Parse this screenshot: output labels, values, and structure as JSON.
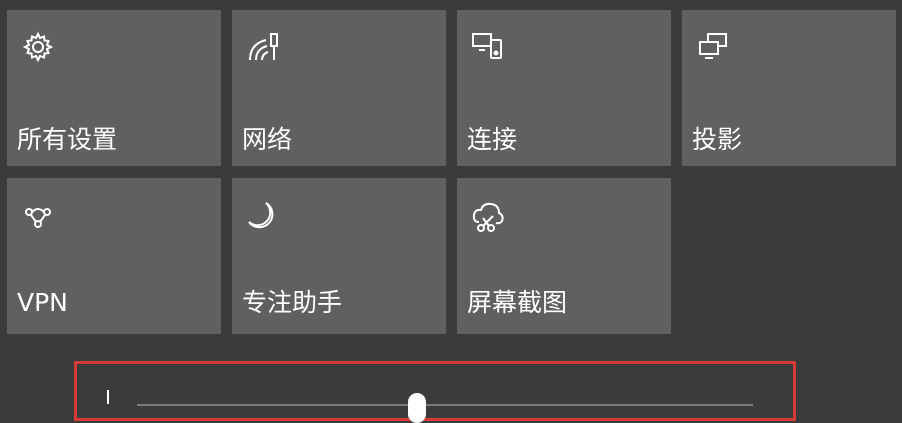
{
  "quick_actions": [
    {
      "label": "所有设置",
      "icon": "gear-icon"
    },
    {
      "label": "网络",
      "icon": "network-signal-icon"
    },
    {
      "label": "连接",
      "icon": "connect-devices-icon"
    },
    {
      "label": "投影",
      "icon": "project-display-icon"
    },
    {
      "label": "VPN",
      "icon": "vpn-icon"
    },
    {
      "label": "专注助手",
      "icon": "moon-icon"
    },
    {
      "label": "屏幕截图",
      "icon": "snip-sketch-icon"
    }
  ],
  "brightness": {
    "icon": "sun-icon",
    "level": 0.45,
    "highlight_color": "#d63a33"
  },
  "colors": {
    "background": "#3b3b3b",
    "tile": "#606060",
    "text": "#ffffff"
  }
}
